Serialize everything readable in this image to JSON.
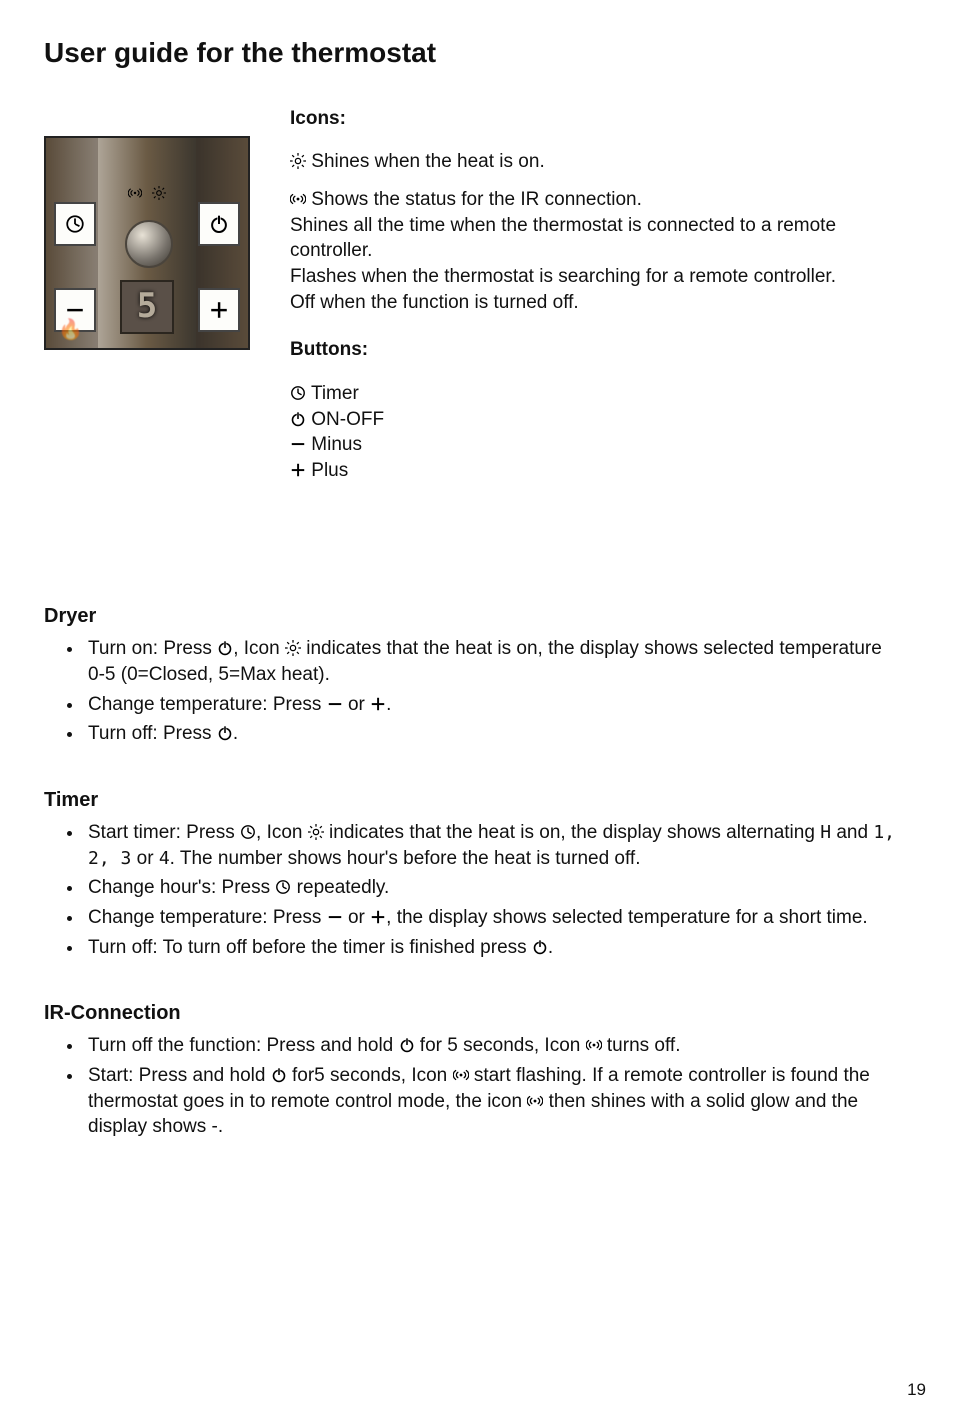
{
  "title": "User guide for the thermostat",
  "page_number": "19",
  "fig_display": "5",
  "icons_heading": "Icons:",
  "icons_line1": "Shines when the heat is on.",
  "icons_line2a": "Shows the status for the IR connection.",
  "icons_line2b": "Shines all the time when the thermostat is connected to a remote controller.",
  "icons_line2c": "Flashes when the thermostat is searching for a remote controller.",
  "icons_line2d": "Off when the function is turned off.",
  "buttons_heading": "Buttons:",
  "btn_timer": "Timer",
  "btn_onoff": "ON-OFF",
  "btn_minus": "Minus",
  "btn_plus": "Plus",
  "dryer_heading": "Dryer",
  "dryer_items": {
    "i1a": "Turn on: Press ",
    "i1b": ", Icon ",
    "i1c": " indicates that the heat is on, the display shows selected temperature 0-5 (0=Closed, 5=Max heat).",
    "i2a": "Change temperature: Press ",
    "i2b": " or ",
    "i2c": ".",
    "i3a": "Turn off: Press ",
    "i3b": "."
  },
  "timer_heading": "Timer",
  "timer_items": {
    "i1a": "Start timer: Press ",
    "i1b": ", Icon ",
    "i1c": " indicates that the heat is on, the display shows alternating ",
    "i1d": "H",
    "i1e": " and ",
    "i1f": "1",
    "i1g": ", ",
    "i1h": "2",
    "i1i": ", ",
    "i1j": "3",
    "i1k": " or ",
    "i1l": "4",
    "i1m": ". The number shows hour's before the heat is turned off.",
    "i2a": "Change hour's: Press ",
    "i2b": " repeatedly.",
    "i3a": "Change temperature: Press ",
    "i3b": " or ",
    "i3c": ", the display shows selected temperature for a short time.",
    "i4a": "Turn off: To turn off before the timer is finished press ",
    "i4b": "."
  },
  "ir_heading": "IR-Connection",
  "ir_items": {
    "i1a": "Turn off the function: Press and hold ",
    "i1b": " for 5 seconds, Icon ",
    "i1c": " turns off.",
    "i2a": "Start: Press and hold ",
    "i2b": " for5 seconds, Icon ",
    "i2c": " start flashing. If a remote controller is found the thermostat goes in to remote control mode, the icon ",
    "i2d": " then shines with a solid glow and the display shows -."
  }
}
